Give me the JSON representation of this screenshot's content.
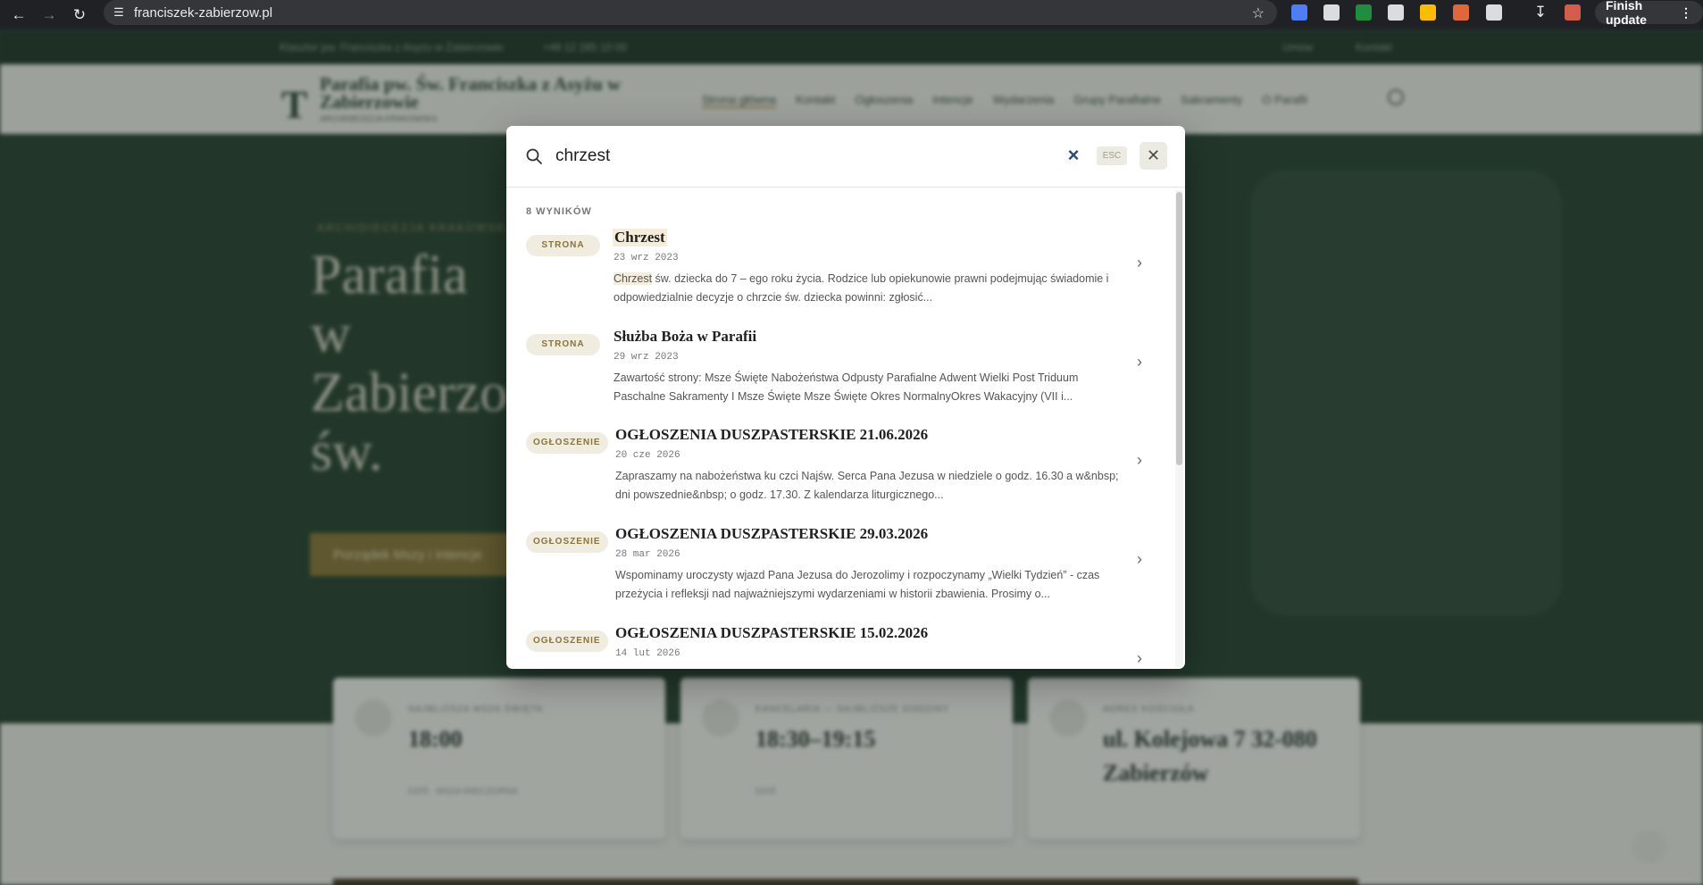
{
  "browser": {
    "url": "franciszek-zabierzow.pl",
    "finish_update_label": "Finish update",
    "extension_colors": [
      "#4f7cf7",
      "#dadce0",
      "#1e8e3e",
      "#dadce0",
      "#fbbc04",
      "#e0673c",
      "#dadce0"
    ]
  },
  "site": {
    "topbar_address": "Klasztor pw. Franciszka z Asyżu w Zabierzowie",
    "topbar_phone": "+48 12 285 10 00",
    "topbar_btn1": "Umów",
    "topbar_btn2": "Kontakt",
    "name": "Parafia pw. Św. Franciszka z Asyżu w Zabierzowie",
    "subtitle": "ARCHIDIECEZJA KRAKOWSKA",
    "menu": [
      "Strona główna",
      "Kontakt",
      "Ogłoszenia",
      "Intencje",
      "Wydarzenia",
      "Grupy Parafialne",
      "Sakramenty",
      "O Parafii"
    ],
    "hero_eyebrow": "ARCHIDIECEZJA KRAKOWSKA",
    "hero_title": "Parafia w Zabierzowie św. Franciszka z Asyżu",
    "hero_button": "Porządek Mszy i Intencje",
    "cards": [
      {
        "label": "NAJBLIŻSZA MSZA ŚWIĘTA",
        "value": "18:00",
        "small": "DZIŚ · MSZA WIECZORNA"
      },
      {
        "label": "KANCELARIA — NAJBLIŻSZE GODZINY",
        "value": "18:30–19:15",
        "small": "DZIŚ"
      },
      {
        "label": "ADRES KOŚCIOŁA",
        "value": "ul. Kolejowa 7 32-080 Zabierzów",
        "small": ""
      }
    ]
  },
  "search": {
    "query": "chrzest",
    "esc_label": "ESC",
    "results_count": "8 WYNIKÓW",
    "results": [
      {
        "type": "STRONA",
        "title": "Chrzest",
        "date": "23 wrz 2023",
        "excerpt_highlight": "Chrzest",
        "excerpt": " św. dziecka do 7 – ego roku życia. Rodzice lub opiekunowie prawni podejmując świadomie i odpowiedzialnie decyzje o chrzcie św. dziecka powinni: zgłosić..."
      },
      {
        "type": "STRONA",
        "title": "Służba Boża w Parafii",
        "date": "29 wrz 2023",
        "excerpt_highlight": "",
        "excerpt": "Zawartość strony: Msze Święte Nabożeństwa Odpusty Parafialne Adwent Wielki Post Triduum Paschalne Sakramenty I Msze Święte Msze Święte Okres NormalnyOkres Wakacyjny (VII i..."
      },
      {
        "type": "OGŁOSZENIE",
        "title": "OGŁOSZENIA DUSZPASTERSKIE  21.06.2026",
        "date": "20 cze 2026",
        "excerpt_highlight": "",
        "excerpt": "Zapraszamy na nabożeństwa ku czci Najśw. Serca Pana Jezusa w niedziele o godz. 16.30 a w&nbsp; dni powszednie&nbsp; o godz. 17.30. Z kalendarza liturgicznego..."
      },
      {
        "type": "OGŁOSZENIE",
        "title": "OGŁOSZENIA DUSZPASTERSKIE 29.03.2026",
        "date": "28 mar 2026",
        "excerpt_highlight": "",
        "excerpt": "Wspominamy uroczysty wjazd Pana Jezusa do Jerozolimy i rozpoczynamy „Wielki Tydzień” - czas przeżycia i refleksji nad najważniejszymi wydarzeniami w historii zbawienia. Prosimy o..."
      },
      {
        "type": "OGŁOSZENIE",
        "title": "OGŁOSZENIA DUSZPASTERSKIE 15.02.2026",
        "date": "14 lut 2026",
        "excerpt_highlight": "",
        "excerpt": ""
      }
    ]
  }
}
